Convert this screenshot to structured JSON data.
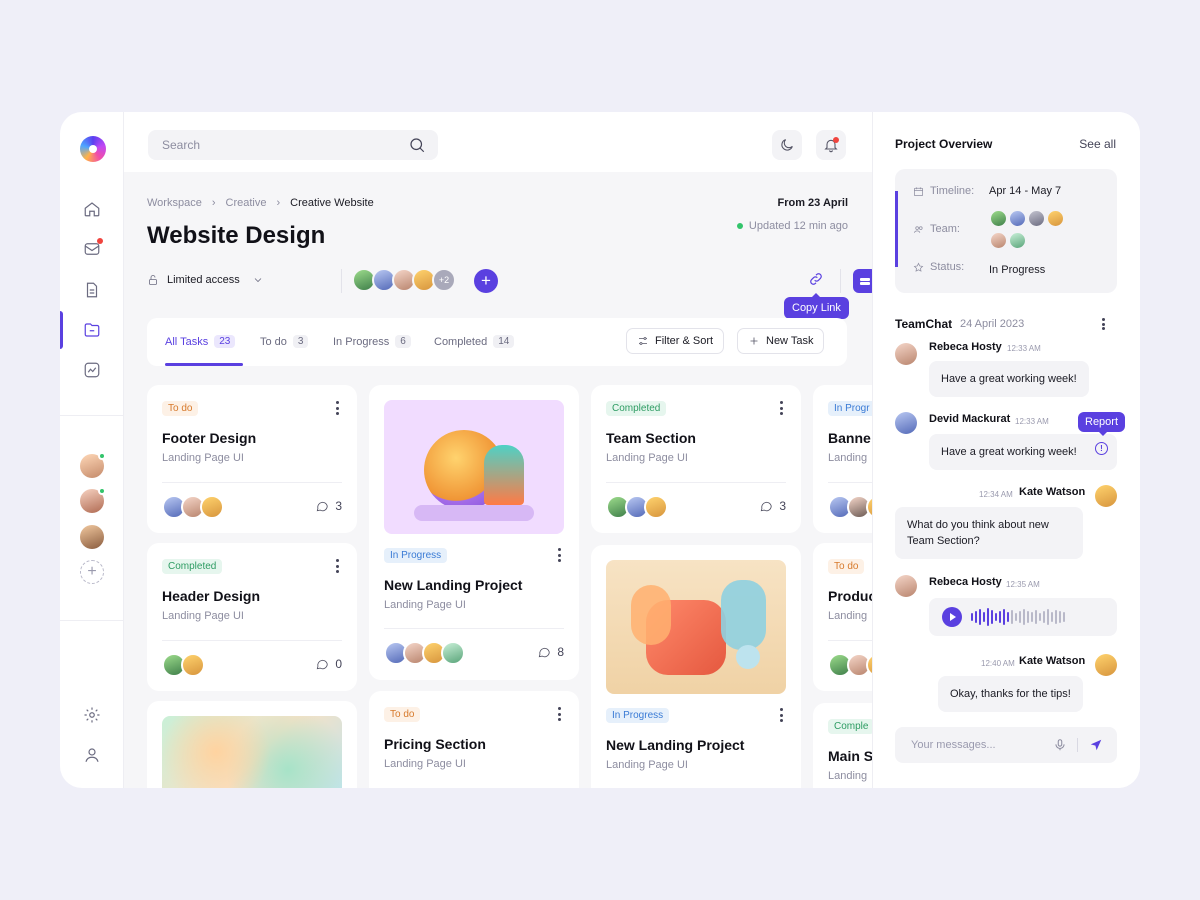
{
  "colors": {
    "accent": "#5a40e0",
    "online": "#33c46b",
    "notification": "#f0443e"
  },
  "search": {
    "placeholder": "Search"
  },
  "breadcrumb": {
    "items": [
      "Workspace",
      "Creative",
      "Creative Website"
    ]
  },
  "header": {
    "title": "Website Design",
    "from_date": "From 23 April",
    "updated": "Updated 12 min ago",
    "access": "Limited access",
    "team_more": "+2",
    "tooltip": "Copy Link"
  },
  "tabs": [
    {
      "label": "All Tasks",
      "count": "23"
    },
    {
      "label": "To do",
      "count": "3"
    },
    {
      "label": "In Progress",
      "count": "6"
    },
    {
      "label": "Completed",
      "count": "14"
    }
  ],
  "toolbar": {
    "filter_label": "Filter & Sort",
    "new_task_label": "New Task"
  },
  "cards": {
    "footer": {
      "status": "To do",
      "title": "Footer Design",
      "subtitle": "Landing Page UI",
      "comments": "3"
    },
    "header_design": {
      "status": "Completed",
      "title": "Header Design",
      "subtitle": "Landing Page UI",
      "comments": "0"
    },
    "landing1": {
      "status": "In Progress",
      "title": "New Landing Project",
      "subtitle": "Landing Page UI",
      "comments": "8"
    },
    "pricing": {
      "status": "To do",
      "title": "Pricing Section",
      "subtitle": "Landing Page UI"
    },
    "team_section": {
      "status": "Completed",
      "title": "Team Section",
      "subtitle": "Landing Page UI",
      "comments": "3"
    },
    "landing2": {
      "status": "In Progress",
      "title": "New Landing Project",
      "subtitle": "Landing Page UI"
    },
    "banner": {
      "status": "In Progr",
      "title": "Banne",
      "subtitle": "Landing"
    },
    "product": {
      "status": "To do",
      "title": "Produc",
      "subtitle": "Landing"
    },
    "main_s": {
      "status": "Comple",
      "title": "Main S",
      "subtitle": "Landing"
    }
  },
  "overview": {
    "title": "Project Overview",
    "see_all": "See all",
    "timeline_label": "Timeline:",
    "timeline_value": "Apr 14 - May 7",
    "team_label": "Team:",
    "status_label": "Status:",
    "status_value": "In Progress"
  },
  "chat": {
    "title": "TeamChat",
    "date": "24 April 2023",
    "report_label": "Report",
    "messages": [
      {
        "name": "Rebeca Hosty",
        "time": "12:33 AM",
        "text": "Have a great working week!"
      },
      {
        "name": "Devid Mackurat",
        "time": "12:33 AM",
        "text": "Have a great working week!"
      },
      {
        "name": "Kate Watson",
        "time": "12:34 AM",
        "text": "What do you think about new Team Section?"
      },
      {
        "name": "Rebeca Hosty",
        "time": "12:35 AM",
        "text": ""
      },
      {
        "name": "Kate Watson",
        "time": "12:40 AM",
        "text": "Okay, thanks for the tips!"
      }
    ],
    "input_placeholder": "Your messages..."
  }
}
